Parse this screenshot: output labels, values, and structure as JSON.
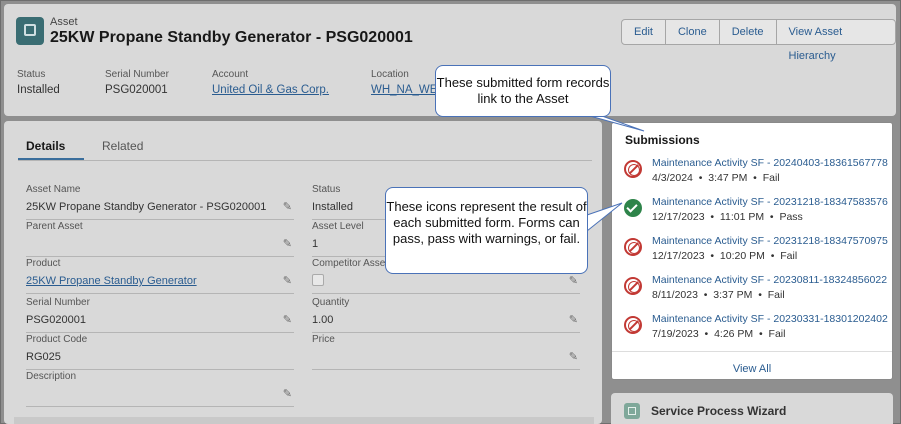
{
  "header": {
    "object_type": "Asset",
    "title": "25KW Propane Standby Generator - PSG020001",
    "actions": [
      "Edit",
      "Clone",
      "Delete",
      "View Asset Hierarchy"
    ],
    "highlights": [
      {
        "label": "Status",
        "value": "Installed"
      },
      {
        "label": "Serial Number",
        "value": "PSG020001"
      },
      {
        "label": "Account",
        "value": "United Oil & Gas Corp."
      },
      {
        "label": "Location",
        "value": "WH_NA_WES"
      }
    ]
  },
  "tabs": {
    "details": "Details",
    "related": "Related"
  },
  "fields": {
    "asset_name": {
      "label": "Asset Name",
      "value": "25KW Propane Standby Generator - PSG020001"
    },
    "status": {
      "label": "Status",
      "value": "Installed"
    },
    "parent_asset": {
      "label": "Parent Asset",
      "value": ""
    },
    "asset_level": {
      "label": "Asset Level",
      "value": "1"
    },
    "product": {
      "label": "Product",
      "value": "25KW Propane Standby Generator"
    },
    "competitor_asset": {
      "label": "Competitor Asset",
      "value": ""
    },
    "serial_number": {
      "label": "Serial Number",
      "value": "PSG020001"
    },
    "quantity": {
      "label": "Quantity",
      "value": "1.00"
    },
    "product_code": {
      "label": "Product Code",
      "value": "RG025"
    },
    "price": {
      "label": "Price",
      "value": ""
    },
    "description": {
      "label": "Description",
      "value": ""
    }
  },
  "submissions": {
    "title": "Submissions",
    "items": [
      {
        "name": "Maintenance Activity SF - 20240403-18361567778",
        "date": "4/3/2024",
        "time": "3:47 PM",
        "result": "Fail",
        "status_icon": "fail-icon"
      },
      {
        "name": "Maintenance Activity SF - 20231218-18347583576",
        "date": "12/17/2023",
        "time": "11:01 PM",
        "result": "Pass",
        "status_icon": "pass-icon"
      },
      {
        "name": "Maintenance Activity SF - 20231218-18347570975",
        "date": "12/17/2023",
        "time": "10:20 PM",
        "result": "Fail",
        "status_icon": "fail-icon"
      },
      {
        "name": "Maintenance Activity SF - 20230811-18324856022",
        "date": "8/11/2023",
        "time": "3:37 PM",
        "result": "Fail",
        "status_icon": "fail-icon"
      },
      {
        "name": "Maintenance Activity SF - 20230331-18301202402",
        "date": "7/19/2023",
        "time": "4:26 PM",
        "result": "Fail",
        "status_icon": "fail-icon"
      }
    ],
    "view_all": "View All"
  },
  "service_wizard": {
    "title": "Service Process Wizard"
  },
  "callouts": {
    "asset_link": "These submitted form records link to the Asset",
    "icons": "These icons represent the result of each submitted form. Forms can pass, pass with warnings, or fail."
  },
  "colors": {
    "link": "#2a5c90",
    "fail": "#c23934",
    "pass": "#2e844a",
    "callout_border": "#4a72b8"
  }
}
